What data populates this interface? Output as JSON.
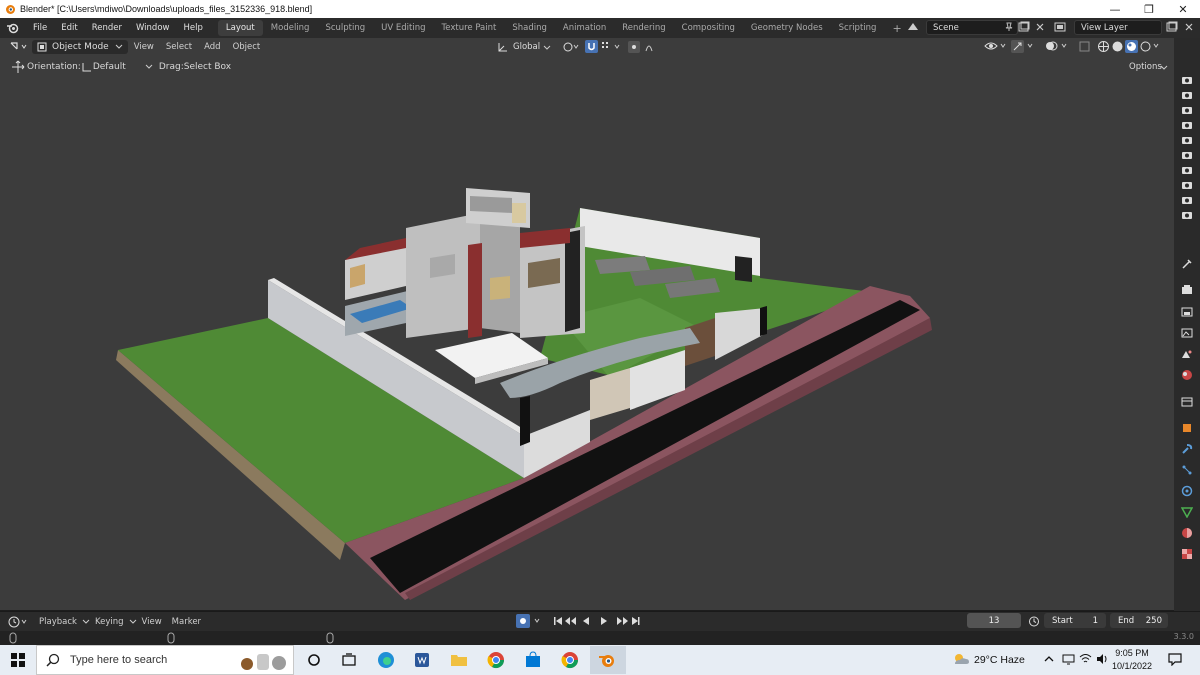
{
  "window": {
    "title": "Blender* [C:\\Users\\mdiwo\\Downloads\\uploads_files_3152336_918.blend]",
    "minimize": "—",
    "maximize": "❐",
    "close": "✕"
  },
  "menu": [
    "File",
    "Edit",
    "Render",
    "Window",
    "Help"
  ],
  "workspaces": {
    "tabs": [
      "Layout",
      "Modeling",
      "Sculpting",
      "UV Editing",
      "Texture Paint",
      "Shading",
      "Animation",
      "Rendering",
      "Compositing",
      "Geometry Nodes",
      "Scripting"
    ],
    "active": "Layout",
    "add": "+"
  },
  "scene": {
    "label": "Scene"
  },
  "view_layer": {
    "label": "View Layer"
  },
  "viewport_header": {
    "mode": "Object Mode",
    "menus": [
      "View",
      "Select",
      "Add",
      "Object"
    ],
    "transform": "Global"
  },
  "tool_settings": {
    "orientation_label": "Orientation:",
    "orientation_value": "Default",
    "drag_label": "Drag:",
    "drag_value": "Select Box",
    "options": "Options"
  },
  "timeline": {
    "menus": [
      "Playback",
      "Keying",
      "View",
      "Marker"
    ],
    "current_frame": "13",
    "start_label": "Start",
    "start_value": "1",
    "end_label": "End",
    "end_value": "250"
  },
  "status": {
    "version": "3.3.0"
  },
  "taskbar": {
    "search_placeholder": "Type here to search",
    "weather": "29°C  Haze",
    "time": "9:05 PM",
    "date": "10/1/2022"
  },
  "colors": {
    "accent": "#4772b3",
    "viewport_bg": "#3c3c3c",
    "grass": "#4f8a35",
    "road": "#8b5560"
  }
}
